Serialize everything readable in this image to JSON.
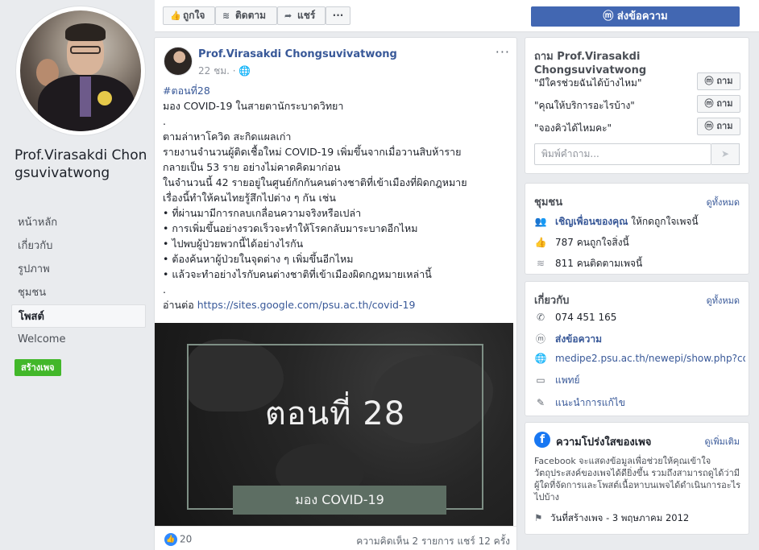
{
  "page": {
    "name": "Prof.Virasakdi Chongsuvivatwong",
    "nav": [
      "หน้าหลัก",
      "เกี่ยวกับ",
      "รูปภาพ",
      "ชุมชน",
      "โพสต์",
      "Welcome"
    ],
    "nav_active": "โพสต์",
    "create_page": "สร้างเพจ"
  },
  "actions": {
    "like": "ถูกใจ",
    "follow": "ติดตาม",
    "share": "แชร์",
    "more": "···",
    "send_message": "ส่งข้อความ"
  },
  "post": {
    "author": "Prof.Virasakdi Chongsuvivatwong",
    "time": "22 ชม.",
    "privacy_icon": "globe-icon",
    "lines": [
      "#ตอนที่28",
      "มอง COVID-19 ในสายตานักระบาดวิทยา",
      ".",
      "ตามล่าหาโควิด สะกิดแผลเก่า",
      "รายงานจำนวนผู้ติดเชื้อใหม่ COVID-19 เพิ่มขึ้นจากเมื่อวานสิบห้าราย",
      "กลายเป็น 53 ราย อย่างไม่คาดคิดมาก่อน",
      "ในจำนวนนี้ 42 รายอยู่ในศูนย์กักกันคนต่างชาติที่เข้าเมืองที่ผิดกฎหมาย",
      "เรื่องนี้ทำให้คนไทยรู้สึกไปต่าง ๆ กัน เช่น",
      "• ที่ผ่านมามีการกลบเกลื่อนความจริงหรือเปล่า",
      "• การเพิ่มขึ้นอย่างรวดเร็วจะทำให้โรคกลับมาระบาดอีกไหม",
      "• ไปพบผู้ป่วยพวกนี้ได้อย่างไรกัน",
      "• ต้องค้นหาผู้ป่วยในจุดต่าง ๆ เพิ่มขึ้นอีกไหม",
      "• แล้วจะทำอย่างไรกับคนต่างชาติที่เข้าเมืองผิดกฎหมายเหล่านี้",
      "."
    ],
    "read_more": "อ่านต่อ",
    "read_more_link": "https://sites.google.com/psu.ac.th/covid-19",
    "image_title": "ตอนที่ 28",
    "image_banner": "มอง COVID-19",
    "likes": "20",
    "comments_shares": "ความคิดเห็น 2 รายการ  แชร์ 12 ครั้ง"
  },
  "ask": {
    "title": "ถาม Prof.Virasakdi Chongsuvivatwong",
    "questions": [
      "\"มีใครช่วยฉันได้บ้างไหม\"",
      "\"คุณให้บริการอะไรบ้าง\"",
      "\"จองคิวได้ไหมคะ\""
    ],
    "ask_label": "ถาม",
    "placeholder": "พิมพ์คำถาม..."
  },
  "community": {
    "title": "ชุมชน",
    "see_all": "ดูทั้งหมด",
    "invite_link": "เชิญเพื่อนของคุณ",
    "invite_rest": " ให้กดถูกใจเพจนี้",
    "likes": "787 คนถูกใจสิ่งนี้",
    "follows": "811 คนติดตามเพจนี้"
  },
  "about": {
    "title": "เกี่ยวกับ",
    "see_all": "ดูทั้งหมด",
    "phone": "074 451 165",
    "message": "ส่งข้อความ",
    "website": "medipe2.psu.ac.th/newepi/show.php?con",
    "category": "แพทย์",
    "suggest": "แนะนำการแก้ไข"
  },
  "transparency": {
    "title": "ความโปร่งใสของเพจ",
    "see_more": "ดูเพิ่มเติม",
    "desc": "Facebook จะแสดงข้อมูลเพื่อช่วยให้คุณเข้าใจวัตถุประสงค์ของเพจได้ดียิ่งขึ้น รวมถึงสามารถดูได้ว่ามีผู้ใดที่จัดการและโพสต์เนื้อหาบนเพจได้ดำเนินการอะไรไปบ้าง",
    "created": "วันที่สร้างเพจ - 3 พฤษภาคม 2012"
  },
  "colors": {
    "accent": "#4267b2",
    "link": "#385898",
    "green": "#42b72a"
  }
}
